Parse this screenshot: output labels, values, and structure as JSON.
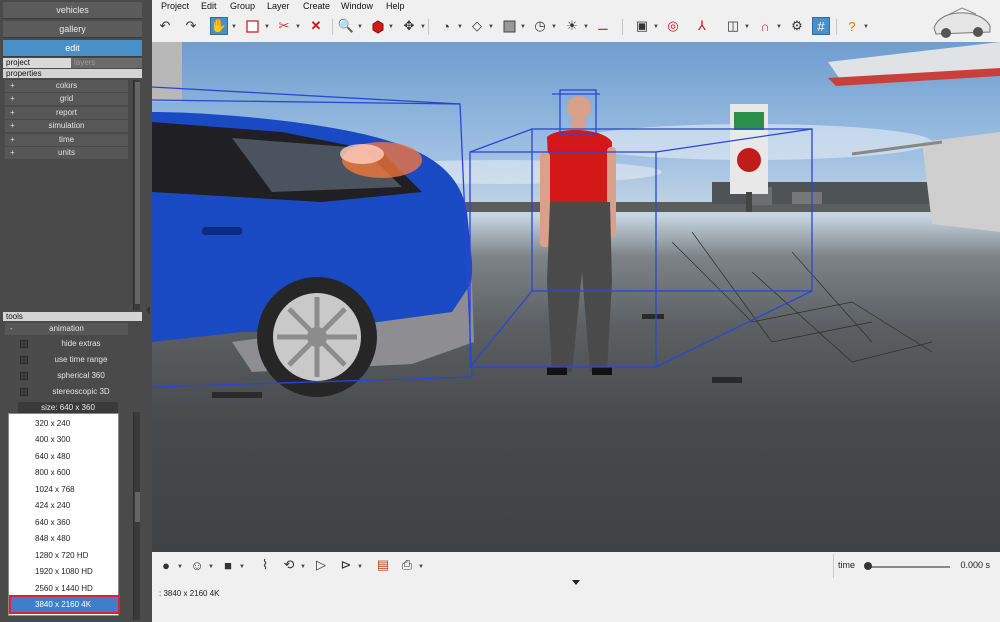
{
  "left": {
    "nav": [
      "vehicles",
      "gallery",
      "edit"
    ],
    "tabs": [
      "project",
      "layers"
    ],
    "properties_header": "properties",
    "property_items": [
      "colors",
      "grid",
      "report",
      "simulation",
      "time",
      "units"
    ],
    "tools_header": "tools",
    "animation_section": "animation",
    "checkboxes": [
      "hide extras",
      "use time range",
      "spherical 360",
      "stereoscopic 3D"
    ],
    "size_button": "size: 640 x 360",
    "size_options": [
      "320 x 240",
      "400 x 300",
      "640 x 480",
      "800 x 600",
      "1024 x 768",
      "424 x 240",
      "640 x 360",
      "848 x 480",
      "1280 x 720 HD",
      "1920 x 1080 HD",
      "2560 x 1440 HD",
      "3840 x 2160 4K"
    ],
    "selected_option": "3840 x 2160 4K"
  },
  "menu": [
    "Project",
    "Edit",
    "Group",
    "Layer",
    "Create",
    "Window",
    "Help"
  ],
  "toolbar_icons": [
    "undo-icon",
    "redo-icon",
    "pan-hand-icon",
    "select-box-icon",
    "cut-icon",
    "delete-icon",
    "zoom-icon",
    "red-cube-icon",
    "move-icon",
    "rotate-view-icon",
    "surface-icon",
    "box-icon",
    "measure-icon",
    "light-icon",
    "tape-icon",
    "camera-icon",
    "target-icon",
    "axes-icon",
    "mirror-icon",
    "magnet-icon",
    "settings-icon",
    "grid-icon",
    "help-icon"
  ],
  "timeline": {
    "time_label": "time",
    "time_value": "0.000 s",
    "slider_position": 0
  },
  "status_text": ": 3840 x 2160 4K",
  "colors": {
    "accent": "#4a90c8",
    "highlight": "#e0202a",
    "panel": "#4a4a4a"
  }
}
